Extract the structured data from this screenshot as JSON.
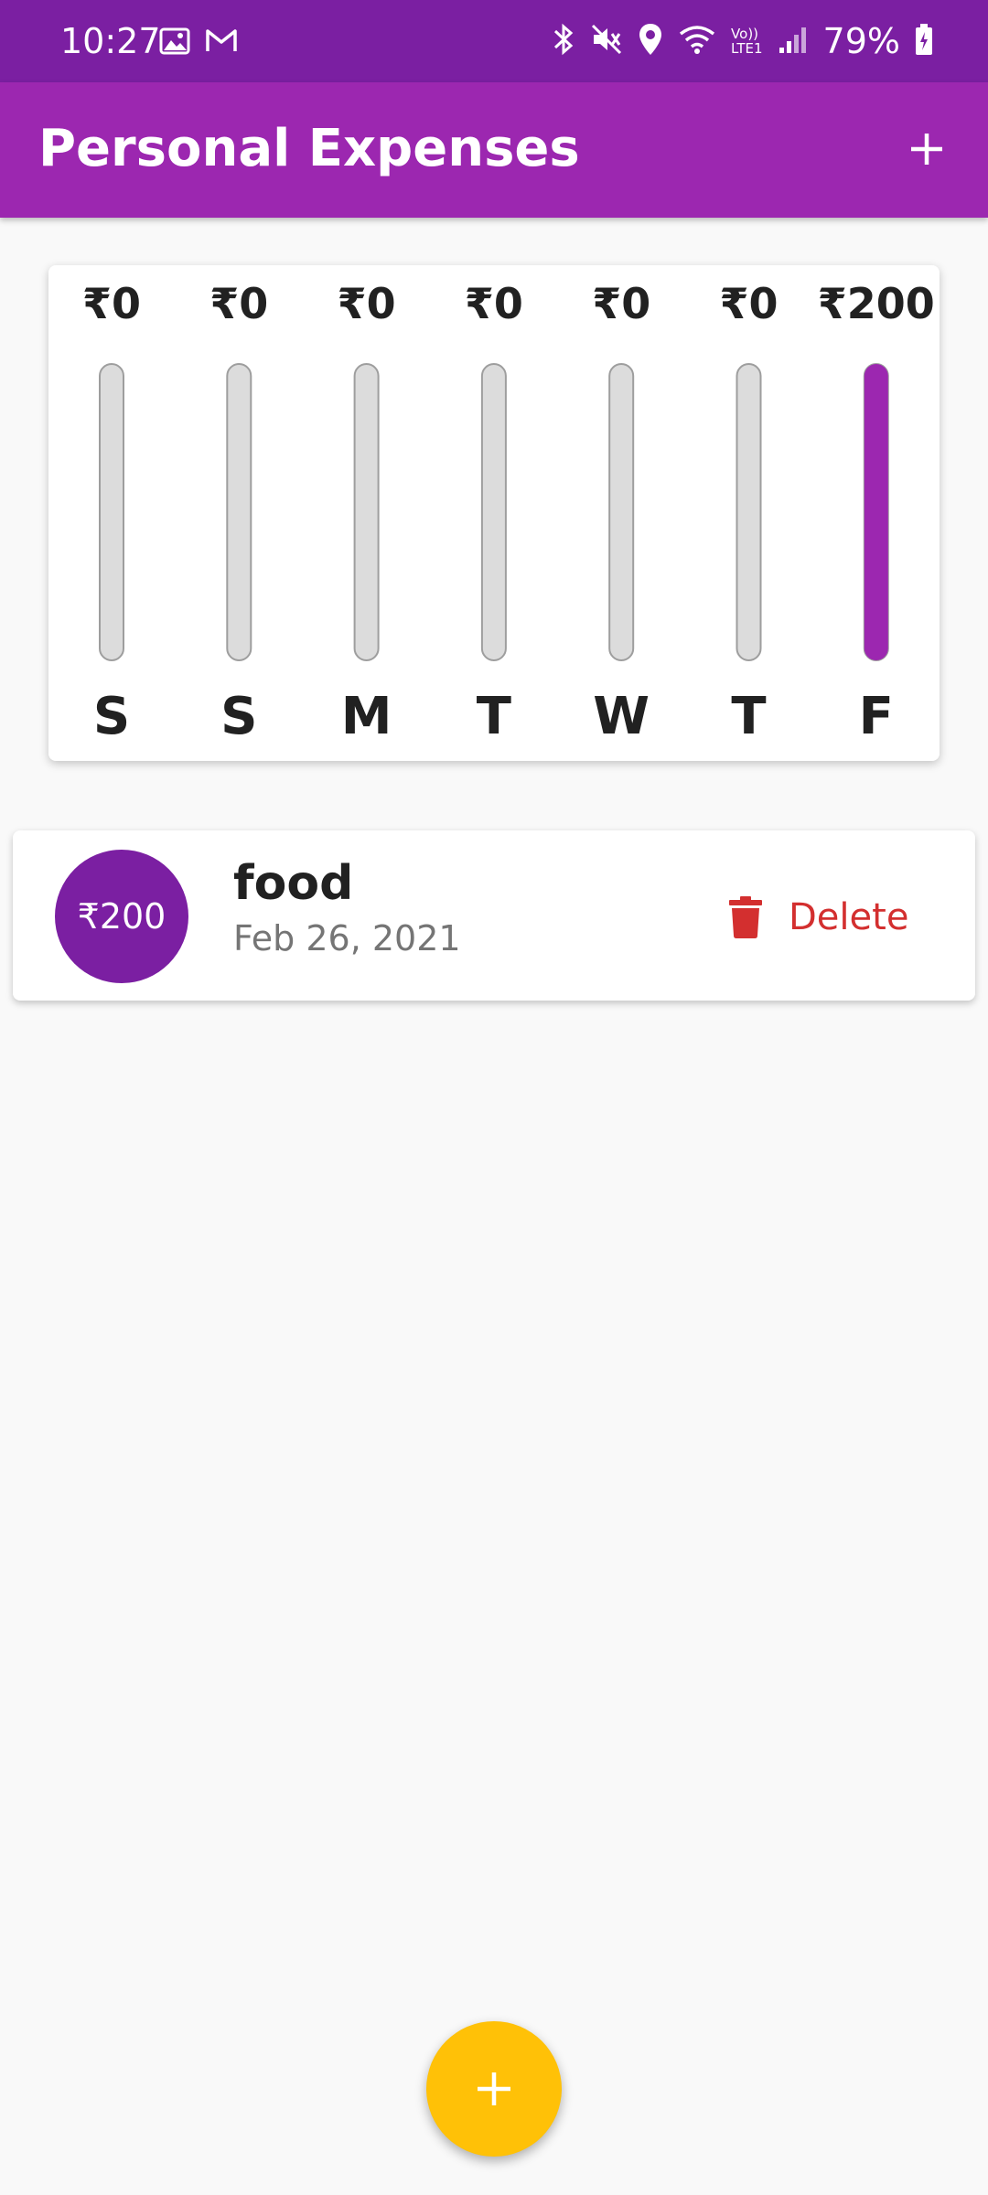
{
  "status_bar": {
    "time": "10:27",
    "battery": "79%",
    "left_icons": [
      "image-icon",
      "gmail-icon"
    ],
    "right_icons": [
      "bluetooth-icon",
      "mute-icon",
      "location-icon",
      "wifi-icon",
      "volte-icon",
      "signal-icon",
      "battery-icon"
    ],
    "volte_label_top": "Vo))",
    "volte_label_bottom": "LTE1"
  },
  "app_bar": {
    "title": "Personal Expenses",
    "action_icon": "add-icon"
  },
  "chart_data": {
    "type": "bar",
    "categories": [
      "S",
      "S",
      "M",
      "T",
      "W",
      "T",
      "F"
    ],
    "values": [
      0,
      0,
      0,
      0,
      0,
      0,
      200
    ],
    "value_labels": [
      "₹0",
      "₹0",
      "₹0",
      "₹0",
      "₹0",
      "₹0",
      "₹200"
    ],
    "ylim": [
      0,
      200
    ],
    "track_color": "#dcdcdc",
    "fill_color": "#9c27b0",
    "label_color": "#212121"
  },
  "transactions": [
    {
      "amount": "₹200",
      "title": "food",
      "date": "Feb 26, 2021",
      "delete_label": "Delete",
      "delete_icon": "trash-icon"
    }
  ],
  "fab": {
    "icon": "add-icon",
    "color": "#ffc107"
  },
  "colors": {
    "status_bar": "#7b1fa2",
    "primary": "#9c27b0",
    "accent": "#ffc107",
    "error": "#d32f2f",
    "background": "#f9f9f9"
  }
}
